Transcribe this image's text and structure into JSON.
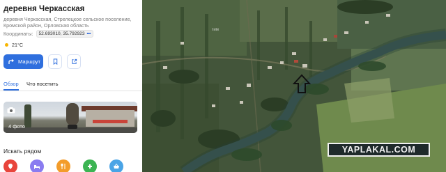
{
  "place": {
    "title": "деревня Черкасская",
    "address": "деревня Черкасская, Стрелецкое сельское поселение, Кромской район, Орловская область",
    "coords_label": "Координаты:",
    "coords_value": "52.693010, 35.792923",
    "weather": "21°C"
  },
  "actions": {
    "route_label": "Маршрут",
    "bookmark_icon": "bookmark-icon",
    "share_icon": "share-icon"
  },
  "tabs": [
    {
      "label": "Обзор",
      "active": true
    },
    {
      "label": "Что посетить",
      "active": false
    }
  ],
  "photos": {
    "count_label": "4 фото"
  },
  "nearby": {
    "title": "Искать рядом",
    "items": [
      {
        "icon": "location-pin-icon",
        "color": "#e8453c"
      },
      {
        "icon": "bed-icon",
        "color": "#8a7cf0"
      },
      {
        "icon": "restaurant-icon",
        "color": "#f39c2b"
      },
      {
        "icon": "pharmacy-plus-icon",
        "color": "#3cb453"
      },
      {
        "icon": "shopping-basket-icon",
        "color": "#4aa4e6"
      }
    ]
  },
  "map": {
    "label": "Тим",
    "watermark": "YAPLAKAL.COM"
  },
  "colors": {
    "accent": "#2f6fde",
    "map_field": "#3e4f33",
    "river": "#3e5a59"
  }
}
